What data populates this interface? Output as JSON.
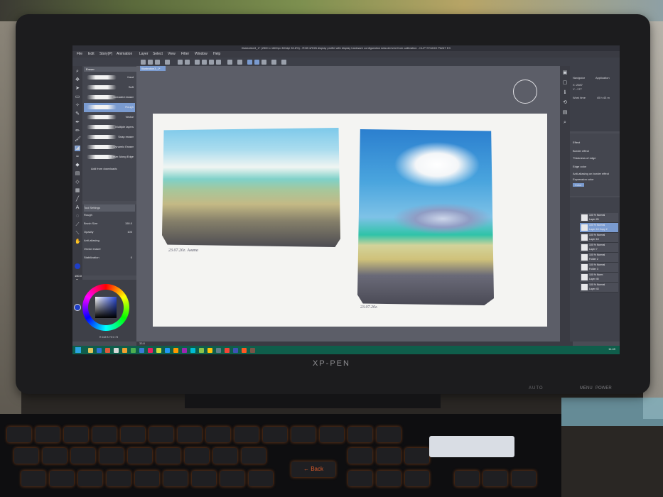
{
  "app": {
    "title": "Illustration3_1* (2500 x 1800px 300dpi 33.8%) - RGB sRGB display profile with display hardware configuration data derived from calibration - CLIP STUDIO PAINT EX",
    "canvas_tab": "Illustration3_1*",
    "zoom": "33.8",
    "menu": [
      "File",
      "Edit",
      "Story(P)",
      "Animation",
      "Layer",
      "Select",
      "View",
      "Filter",
      "Window",
      "Help"
    ]
  },
  "subtool": {
    "header": "Eraser",
    "brushes": [
      "Hard",
      "Soft",
      "Kneaded eraser",
      "Rough",
      "Vector",
      "Multiple layers",
      "Snap eraser",
      "Dynamic Eraser",
      "Eraser Along Edge"
    ],
    "add_from_downloads": "Add from downloads"
  },
  "tool_property": {
    "title": "Tool Settings",
    "brush_preset": "Rough",
    "brush_size_label": "Brush Size",
    "brush_size_value": "150.0",
    "opacity_label": "Opacity",
    "opacity_value": "100",
    "antialias_label": "Anti-aliasing",
    "vector_eraser_label": "Vector eraser",
    "stabilization_label": "Stabilization",
    "stabilization_value": "0"
  },
  "left_slider": {
    "size_value": "150.0",
    "opacity_value": "100"
  },
  "color": {
    "main": "#1f3fc8",
    "readout": "R 242 B 75 G 73"
  },
  "navigator": {
    "tab1": "Navigator",
    "tab2": "Application",
    "x": "X: 2087",
    "y": "Y: -177",
    "work_time": "Work time",
    "work_time_value": "45 h 43 m"
  },
  "effect": {
    "title": "Effect",
    "border_effect": "Border effect",
    "thickness_label": "Thickness of edge",
    "edge_color_label": "Edge color",
    "antialias_border": "Anti-aliasing on border effect",
    "expression_color": "Expression color",
    "expression_color_value": "Color"
  },
  "layers": [
    {
      "mode": "100 % Normal",
      "name": "Layer 26",
      "selected": false
    },
    {
      "mode": "100 % Normal",
      "name": "Layer 18 Copy 2",
      "selected": true
    },
    {
      "mode": "100 % Normal",
      "name": "Layer 18",
      "selected": false
    },
    {
      "mode": "100 % Normal",
      "name": "Layer 7",
      "selected": false
    },
    {
      "mode": "100 % Normal",
      "name": "Folder 2",
      "selected": false
    },
    {
      "mode": "100 % Normal",
      "name": "Folder 3",
      "selected": false
    },
    {
      "mode": "100 % Norm",
      "name": "Layer 45",
      "selected": false
    },
    {
      "mode": "100 % Normal",
      "name": "Layer 43",
      "selected": false
    }
  ],
  "paintings": {
    "sig1": "23.07.20г. Анапа",
    "sig2": "23.07.20г."
  },
  "status": {
    "zoom": "33.8"
  },
  "taskbar": {
    "time": "11:49"
  },
  "monitor": {
    "brand": "XP-PEN",
    "auto": "AUTO",
    "menu": "MENU",
    "power": "POWER"
  },
  "keyboard": {
    "backspace": "← Back"
  }
}
